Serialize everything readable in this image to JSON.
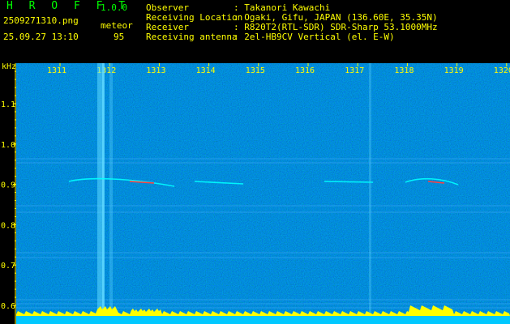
{
  "app": {
    "title": "H R O F F T",
    "version": "1.0.0"
  },
  "file": {
    "name": "2509271310.png",
    "datetime": "25.09.27 13:10"
  },
  "mode": {
    "label": "meteor",
    "count": "95"
  },
  "info": [
    {
      "key": "Observer",
      "value": ": Takanori Kawachi"
    },
    {
      "key": "Receiving Location",
      "value": ": Ogaki, Gifu, JAPAN (136.60E, 35.35N)"
    },
    {
      "key": "Receiver",
      "value": ": R820T2(RTL-SDR) SDR-Sharp 53.1000MHz"
    },
    {
      "key": "Receiving antenna",
      "value": ": 2el-HB9CV Vertical (el. E-W)"
    }
  ],
  "axes": {
    "y_unit": "kHz",
    "y_ticks": [
      "1.1",
      "1.0",
      "0.9",
      "0.8",
      "0.7",
      "0.6"
    ],
    "x_ticks": [
      "1311",
      "1312",
      "1313",
      "1314",
      "1315",
      "1316",
      "1317",
      "1318",
      "1319",
      "1320"
    ]
  },
  "colors": {
    "background": "#0a1a9a",
    "signal": "#00ffff",
    "echo": "#ff4040",
    "marker_axis": "#ffff00",
    "header_green": "#00ff00",
    "info_yellow": "#ffff00"
  }
}
